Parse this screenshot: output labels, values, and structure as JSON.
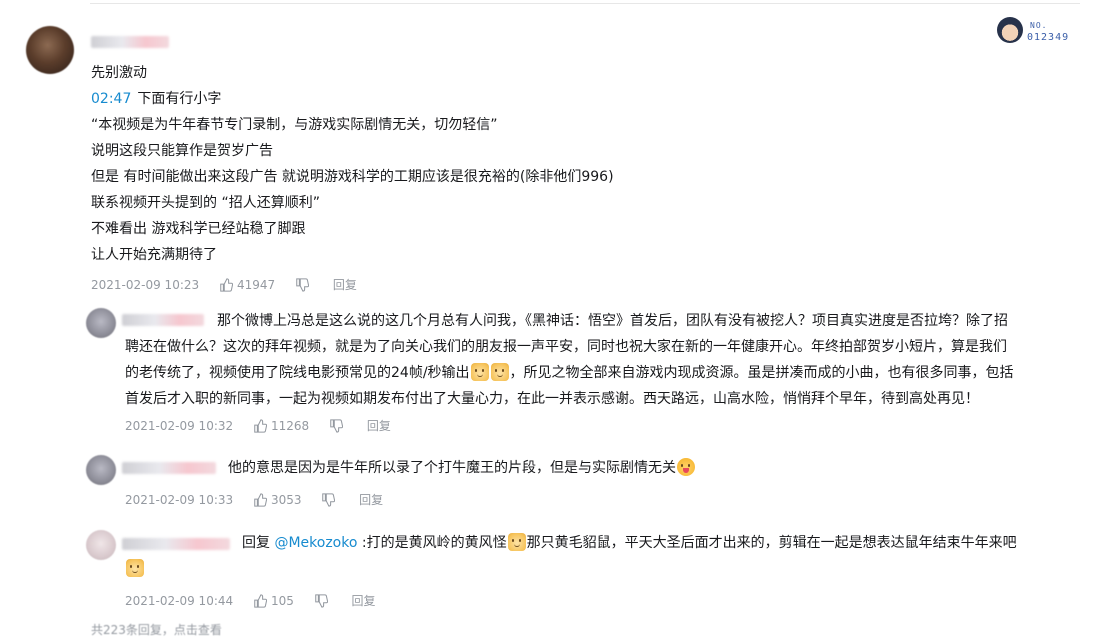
{
  "header_badge": {
    "no_label": "NO.",
    "number": "012349"
  },
  "main_comment": {
    "lines": [
      "先别激动",
      "下面有行小字",
      "“本视频是为牛年春节专门录制，与游戏实际剧情无关，切勿轻信”",
      "说明这段只能算作是贺岁广告",
      "但是 有时间能做出来这段广告 就说明游戏科学的工期应该是很充裕的(除非他们996)",
      "联系视频开头提到的 “招人还算顺利”",
      "不难看出 游戏科学已经站稳了脚跟",
      "让人开始充满期待了"
    ],
    "timestamp_link": "02:47",
    "date": "2021-02-09 10:23",
    "likes": "41947",
    "reply_label": "回复"
  },
  "replies": [
    {
      "text_lines": [
        "那个微博上冯总是这么说的这几个月总有人问我，《黑神话：悟空》首发后，团队有没有被挖人？项目真实进度是否拉垮？除了招",
        "聘还在做什么？这次的拜年视频，就是为了向关心我们的朋友报一声平安，同时也祝大家在新的一年健康开心。年终拍部贺岁小短片，算是我们",
        "的老传统了，视频使用了院线电影预常见的24帧/秒输出",
        "，所见之物全部来自游戏内现成资源。虽是拼凑而成的小曲，也有很多同事，包括",
        "首发后才入职的新同事，一起为视频如期发布付出了大量心力，在此一并表示感谢。西天路远，山高水险，悄悄拜个早年，待到高处再见！"
      ],
      "date": "2021-02-09 10:32",
      "likes": "11268",
      "reply_label": "回复"
    },
    {
      "text": "他的意思是因为是牛年所以录了个打牛魔王的片段，但是与实际剧情无关",
      "date": "2021-02-09 10:33",
      "likes": "3053",
      "reply_label": "回复"
    },
    {
      "prefix": "回复 ",
      "mention": "@Mekozoko",
      "text_a": " :打的是黄风岭的黄风怪",
      "text_b": "那只黄毛貂鼠，平天大圣后面才出来的，剪辑在一起是想表达鼠年结束牛年来吧",
      "date": "2021-02-09 10:44",
      "likes": "105",
      "reply_label": "回复"
    }
  ],
  "footer": {
    "text": "共223条回复，点击查看"
  },
  "icons": {
    "like": "thumbs-up-icon",
    "dislike": "thumbs-down-icon",
    "emote": "cat-face-emote-icon",
    "emote2": "tongue-face-emote-icon"
  },
  "colors": {
    "link": "#178bcf",
    "meta": "#9499a0",
    "text": "#18191c"
  }
}
